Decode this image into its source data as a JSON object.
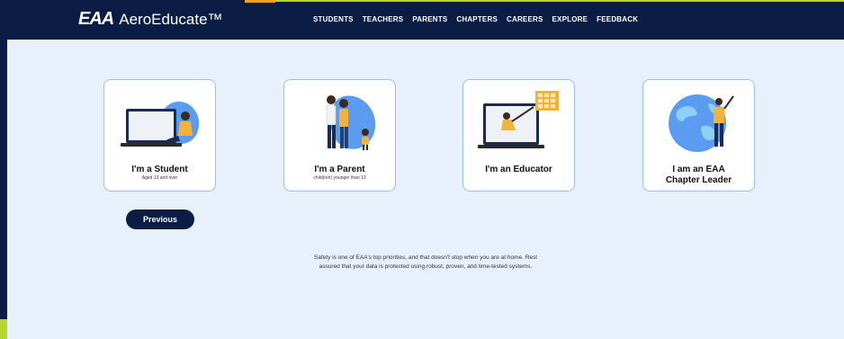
{
  "header": {
    "logo_mark": "EAA",
    "logo_text": "AeroEducate™",
    "nav": [
      "STUDENTS",
      "TEACHERS",
      "PARENTS",
      "CHAPTERS",
      "CAREERS",
      "EXPLORE",
      "FEEDBACK"
    ]
  },
  "cards": [
    {
      "title": "I'm a Student",
      "subtitle": "Aged 13 and over"
    },
    {
      "title": "I'm a Parent",
      "subtitle": "child(ren) younger than 13"
    },
    {
      "title": "I'm an Educator",
      "subtitle": ""
    },
    {
      "title": "I am an EAA Chapter Leader",
      "subtitle": ""
    }
  ],
  "previous_label": "Previous",
  "safety_text": "Safety is one of EAA's top priorities, and that doesn't stop when you are at home. Rest assured that your data is protected using robust, proven, and time-tested systems.",
  "colors": {
    "navy": "#0b1d45",
    "accent_orange": "#f4a020",
    "accent_green": "#b7d433",
    "blob_blue": "#5b9bf0",
    "person_yellow": "#f2b33a"
  }
}
